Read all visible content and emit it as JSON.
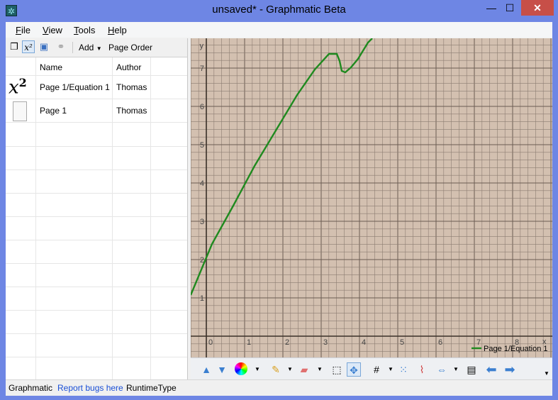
{
  "window": {
    "title": "unsaved* - Graphmatic Beta"
  },
  "menu": [
    {
      "label": "File",
      "underline": "F",
      "rest": "ile"
    },
    {
      "label": "View",
      "underline": "V",
      "rest": "iew"
    },
    {
      "label": "Tools",
      "underline": "T",
      "rest": "ools"
    },
    {
      "label": "Help",
      "underline": "H",
      "rest": "elp"
    }
  ],
  "left_toolbar": {
    "add_label": "Add",
    "page_order_label": "Page Order"
  },
  "table": {
    "headers": {
      "name": "Name",
      "author": "Author"
    },
    "rows": [
      {
        "name": "Page 1/Equation 1",
        "author": "Thomas",
        "icon": "equation-icon"
      },
      {
        "name": "Page 1",
        "author": "Thomas",
        "icon": "page-icon"
      }
    ]
  },
  "graph": {
    "x_ticks": [
      "0",
      "1",
      "2",
      "3",
      "4",
      "5",
      "6",
      "7",
      "8"
    ],
    "y_ticks": [
      "1",
      "2",
      "3",
      "4",
      "5",
      "6",
      "7"
    ],
    "x_axis_label": "x",
    "y_axis_label": "y",
    "legend": "Page 1/Equation 1",
    "line_color": "#1f8a1f",
    "background": "#d3c0b0"
  },
  "status": {
    "app": "Graphmatic",
    "report": "Report bugs here",
    "runtime": "RuntimeType"
  }
}
